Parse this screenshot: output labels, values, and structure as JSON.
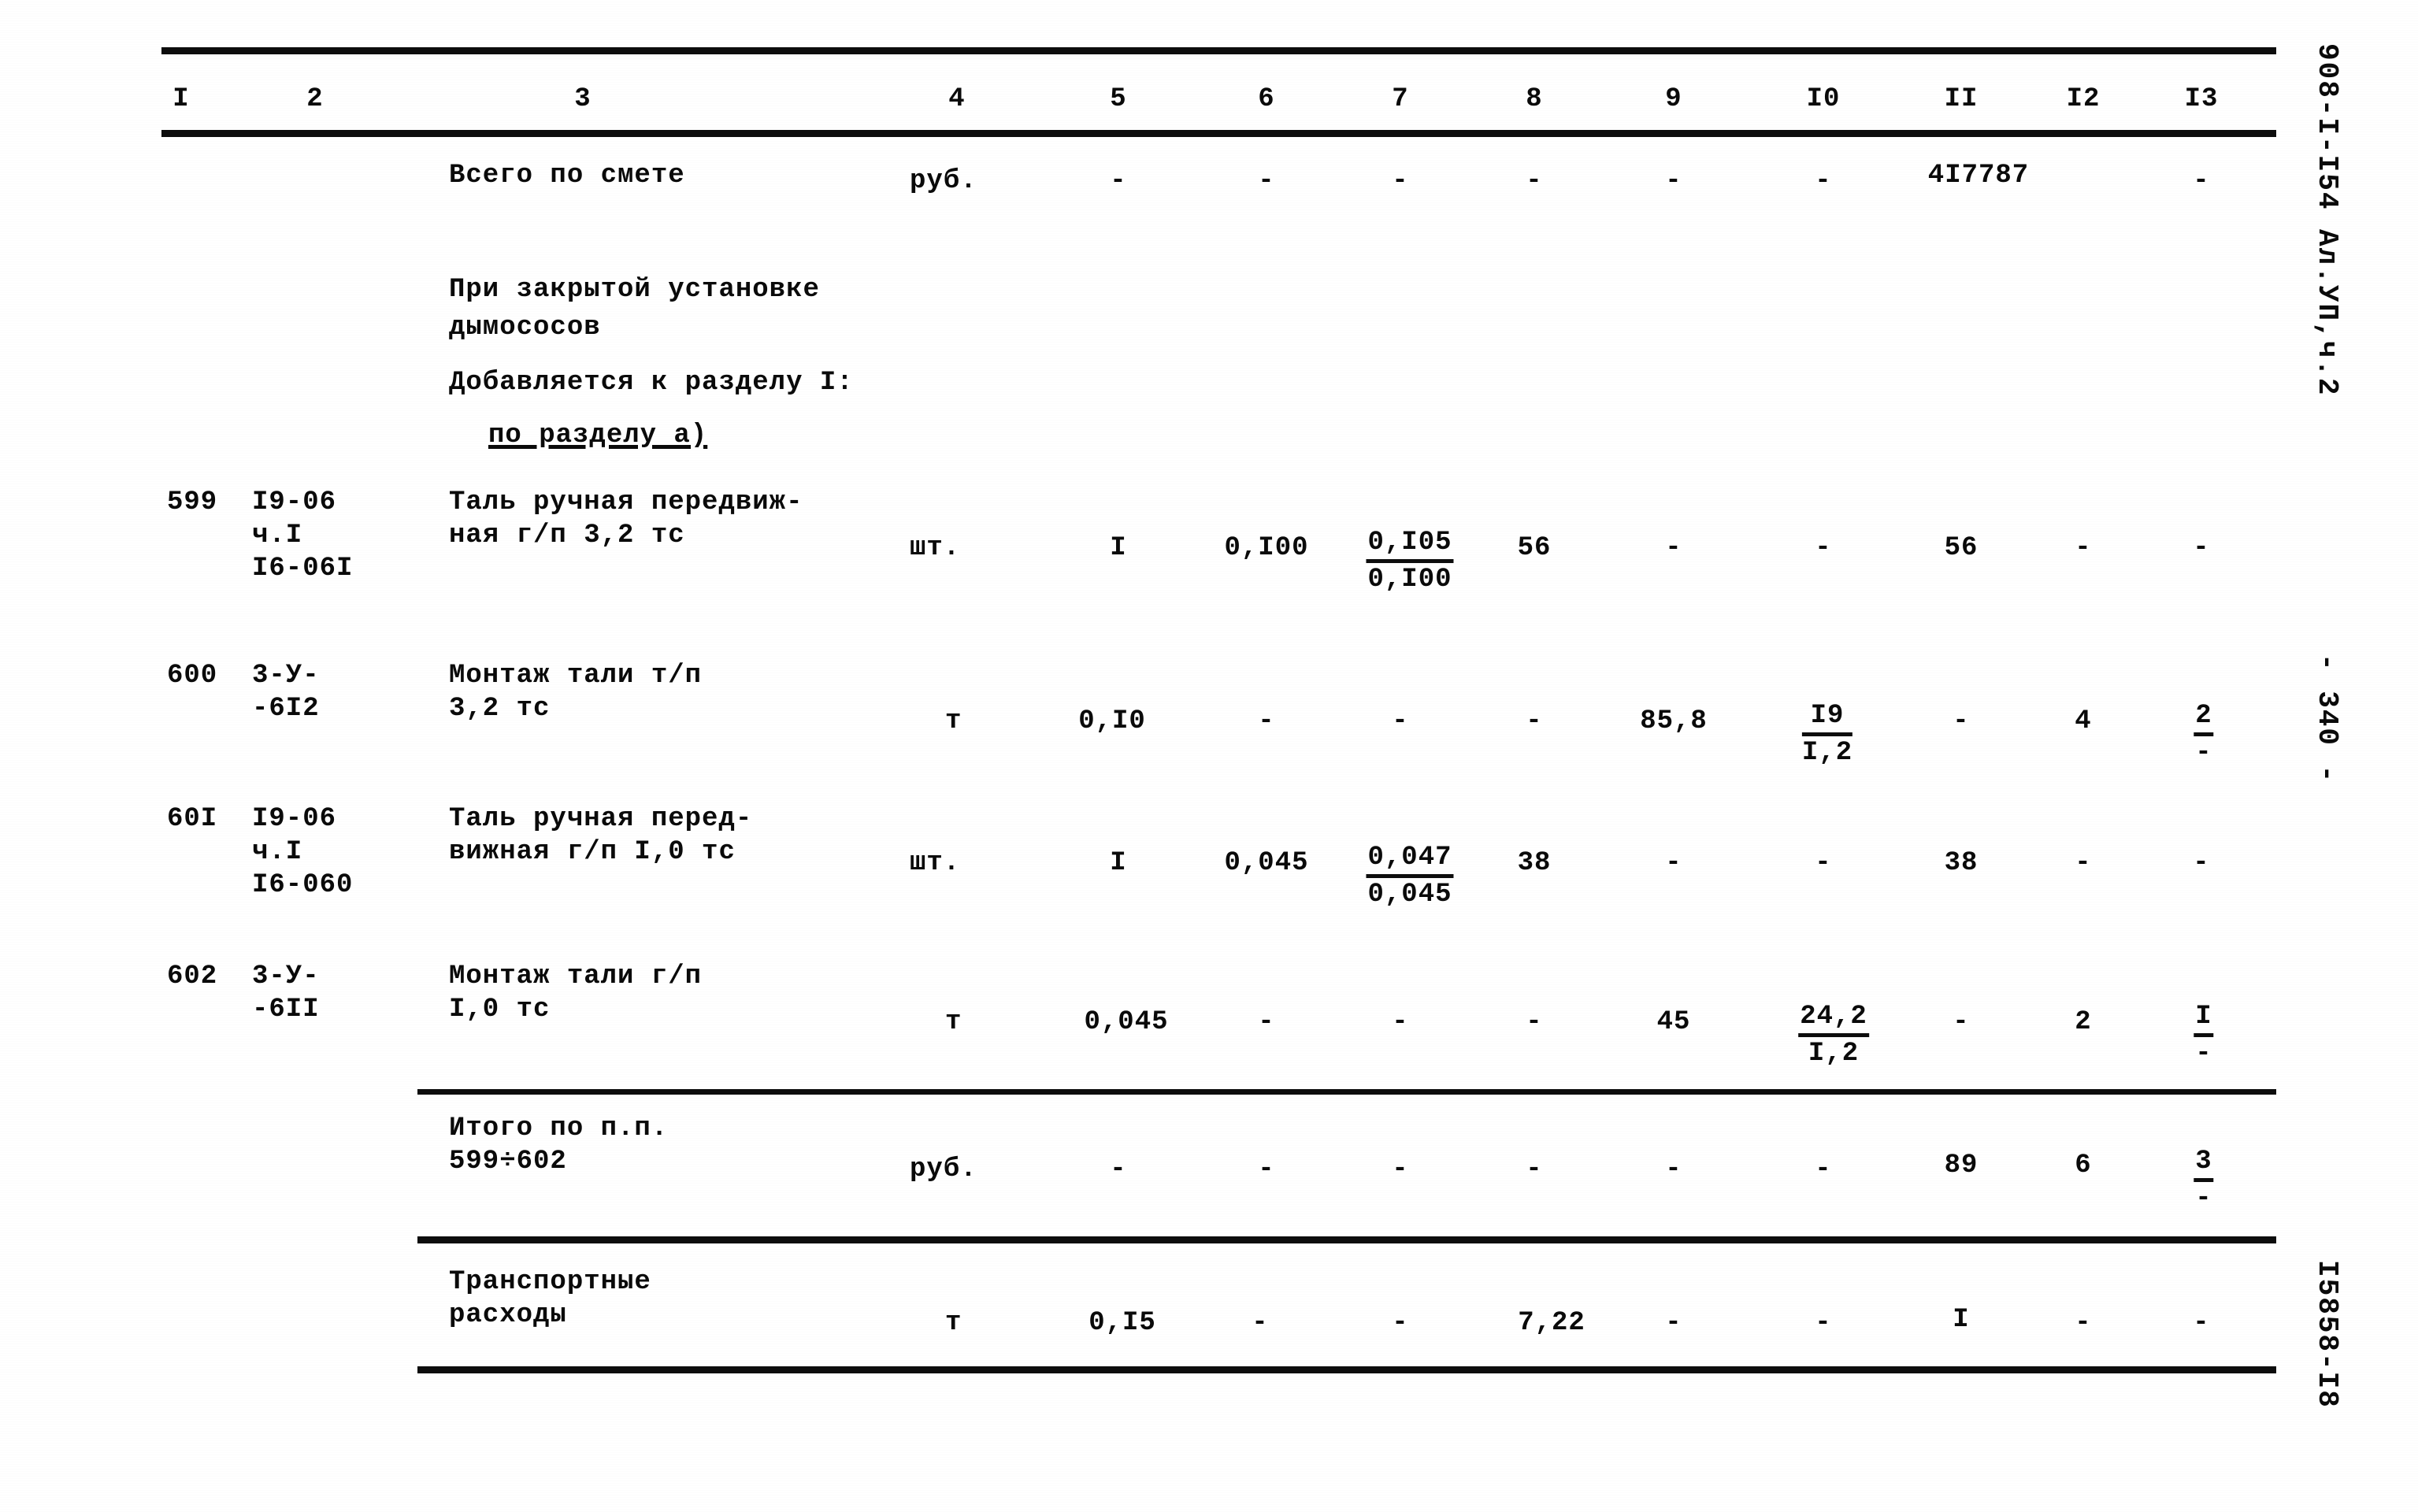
{
  "document": {
    "margin_right": {
      "album_ref": "908-I-I54 Ал.УП,ч.2",
      "page_number": "- 340 -",
      "drawing_number": "I5858-I8"
    }
  },
  "table": {
    "column_headers": [
      "I",
      "2",
      "3",
      "4",
      "5",
      "6",
      "7",
      "8",
      "9",
      "I0",
      "II",
      "I2",
      "I3"
    ],
    "rows": [
      {
        "kind": "total",
        "code_no": "",
        "norm_code": "",
        "name": "Всего по смете",
        "unit": "руб.",
        "c5": "-",
        "c6": "-",
        "c7": "-",
        "c8": "-",
        "c9": "-",
        "c10": "-",
        "c11": "4I7787",
        "c12": "",
        "c13": "-"
      },
      {
        "kind": "heading",
        "lines": [
          "При закрытой установке",
          "дымососов"
        ]
      },
      {
        "kind": "heading",
        "lines": [
          "Добавляется к разделу I:"
        ]
      },
      {
        "kind": "subheading_underlined",
        "lines": [
          "по разделу а)"
        ]
      },
      {
        "kind": "item",
        "code_no": "599",
        "norm_code_lines": [
          "I9-06",
          "ч.I",
          "I6-06I"
        ],
        "name_lines": [
          "Таль ручная передвиж-",
          "ная г/п 3,2 тс"
        ],
        "unit": "шт.",
        "c5": "I",
        "c6": "0,I00",
        "c7_num": "0,I05",
        "c7_den": "0,I00",
        "c8": "56",
        "c9": "-",
        "c10": "-",
        "c11": "56",
        "c12": "-",
        "c13": "-"
      },
      {
        "kind": "item",
        "code_no": "600",
        "norm_code_lines": [
          "3-У-",
          "-6I2"
        ],
        "name_lines": [
          "Монтаж тали т/п",
          "3,2 тс"
        ],
        "unit": "т",
        "c5": "0,I0",
        "c6": "-",
        "c7": "-",
        "c8": "-",
        "c9": "85,8",
        "c10_num": "I9",
        "c10_den": "I,2",
        "c11": "-",
        "c12": "4",
        "c13_num": "2",
        "c13_den": "-"
      },
      {
        "kind": "item",
        "code_no": "60I",
        "norm_code_lines": [
          "I9-06",
          "ч.I",
          "I6-060"
        ],
        "name_lines": [
          "Таль ручная перед-",
          "вижная г/п I,0 тс"
        ],
        "unit": "шт.",
        "c5": "I",
        "c6": "0,045",
        "c7_num": "0,047",
        "c7_den": "0,045",
        "c8": "38",
        "c9": "-",
        "c10": "-",
        "c11": "38",
        "c12": "-",
        "c13": "-"
      },
      {
        "kind": "item",
        "code_no": "602",
        "norm_code_lines": [
          "3-У-",
          "-6II"
        ],
        "name_lines": [
          "Монтаж тали г/п",
          "I,0 тс"
        ],
        "unit": "т",
        "c5": "0,045",
        "c6": "-",
        "c7": "-",
        "c8": "-",
        "c9": "45",
        "c10_num": "24,2",
        "c10_den": "I,2",
        "c11": "-",
        "c12": "2",
        "c13_num": "I",
        "c13_den": "-"
      },
      {
        "kind": "subtotal",
        "name_lines": [
          "Итого по п.п.",
          "599÷602"
        ],
        "unit": "руб.",
        "c5": "-",
        "c6": "-",
        "c7": "-",
        "c8": "-",
        "c9": "-",
        "c10": "-",
        "c11": "89",
        "c12": "6",
        "c13_num": "3",
        "c13_den": "-"
      },
      {
        "kind": "transport",
        "name_lines": [
          "Транспортные",
          "расходы"
        ],
        "unit": "т",
        "c5": "0,I5",
        "c6": "-",
        "c7": "-",
        "c8": "7,22",
        "c9": "-",
        "c10": "-",
        "c11": "I",
        "c12": "-",
        "c13": "-"
      }
    ]
  }
}
